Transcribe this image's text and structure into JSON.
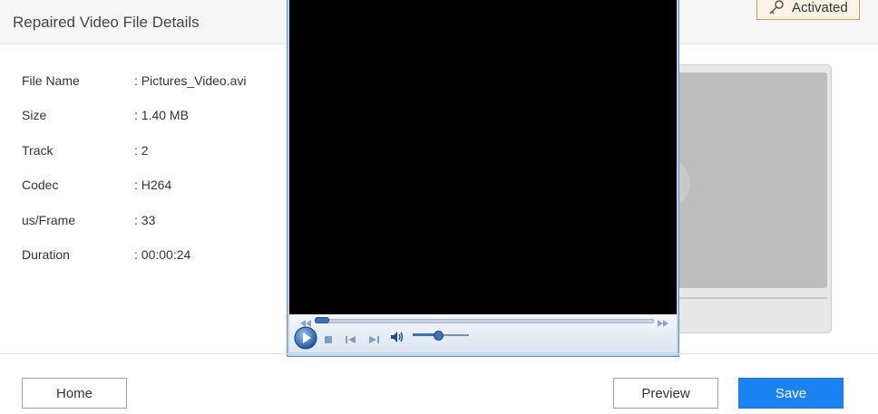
{
  "header": {
    "title": "Repaired Video File Details",
    "activation_label": "Activated"
  },
  "details": [
    {
      "label": "File Name",
      "value": ": Pictures_Video.avi"
    },
    {
      "label": "Size",
      "value": ": 1.40 MB"
    },
    {
      "label": "Track",
      "value": ": 2"
    },
    {
      "label": "Codec",
      "value": ": H264"
    },
    {
      "label": "us/Frame",
      "value": ": 33"
    },
    {
      "label": "Duration",
      "value": ": 00:00:24"
    }
  ],
  "player": {
    "seek_progress": 0.02,
    "volume_level": 0.45
  },
  "footer": {
    "home_label": "Home",
    "preview_label": "Preview",
    "save_label": "Save"
  },
  "icons": {
    "activation": "key-icon",
    "play": "play-icon",
    "stop": "stop-icon",
    "previous": "previous-icon",
    "next": "next-icon",
    "volume": "volume-icon",
    "rewind": "rewind-icon",
    "fast_forward": "fast-forward-icon"
  },
  "colors": {
    "save_button": "#1a82f1",
    "activated_border": "#c89c5a",
    "player_accent": "#3d6fb3"
  }
}
